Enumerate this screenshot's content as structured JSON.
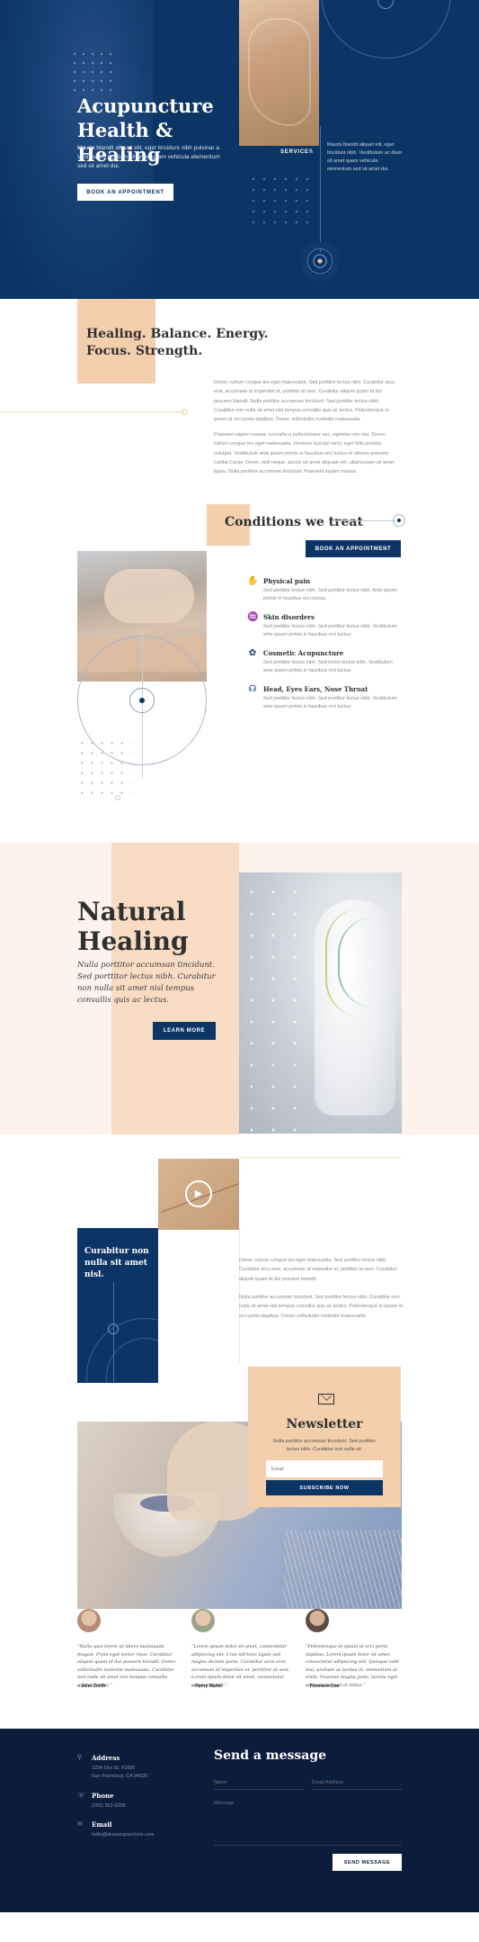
{
  "hero": {
    "title_line1": "Acupuncture",
    "title_line2": "Health & Healing",
    "text": "Mauris blandit aliquet elit, eget tincidunt nibh pulvinar a. Vestibulum ac diam sit amet quam vehicula elementum sed sit amet dui.",
    "button": "BOOK AN APPOINTMENT",
    "services_label": "SERVICES",
    "side_text": "Mauris blandit aliquet elit, eget tincidunt nibh. Vestibulum ac diam sit amet quam vehicula elementum sed sit amet dui."
  },
  "balance": {
    "title_line1": "Healing. Balance. Energy.",
    "title_line2": "Focus. Strength.",
    "para1": "Donec rutrum congue leo eget malesuada. Sed porttitor lectus nibh. Curabitur arcu erat, accumsan id imperdiet et, porttitor at sem. Curabitur aliquet quam id dui posuere blandit. Nulla porttitor accumsan tincidunt. Sed porttitor lectus nibh. Curabitur non nulla sit amet nisl tempus convallis quis ac lectus. Pellentesque in ipsum id orci porta dapibus. Donec sollicitudin molestie malesuada.",
    "para2": "Praesent sapien massa, convallis a pellentesque nec, egestas non nisi. Donec rutrum congue leo eget malesuada. Vivamus suscipit tortor eget felis porttitor volutpat. Vestibulum ante ipsum primis in faucibus orci luctus et ultrices posuere cubilia Curae; Donec velit neque, auctor sit amet aliquam vel, ullamcorper sit amet ligula. Nulla porttitor accumsan tincidunt. Praesent sapien massa."
  },
  "conditions": {
    "title": "Conditions we treat",
    "button": "BOOK AN APPOINTMENT",
    "items": [
      {
        "icon": "pain-hand-icon",
        "glyph": "✋",
        "title": "Physical pain",
        "text": "Sed porttitor lectus nibh. Sed porttitor lectus nibh. Ante ipsum primis in faucibus orci luctus."
      },
      {
        "icon": "skin-icon",
        "glyph": "♒",
        "title": "Skin disorders",
        "text": "Sed porttitor lectus nibh. Sed porttitor lectus nibh. Vestibulum ante ipsum primis in faucibus orci luctus."
      },
      {
        "icon": "cosmetic-icon",
        "glyph": "✿",
        "title": "Cosmetic Acupuncture",
        "text": "Sed porttitor lectus nibh. Sed lorem lectus nibh. Vestibulum ante ipsum primis in faucibus orci luctus."
      },
      {
        "icon": "head-icon",
        "glyph": "☊",
        "title": "Head, Eyes Ears, Nose Throat",
        "text": "Sed porttitor lectus nibh. Sed porttitor lectus nibh. Vestibulum ante ipsum primis in faucibus orci luctus."
      }
    ]
  },
  "natural": {
    "title_line1": "Natural",
    "title_line2": "Healing",
    "text": "Nulla porttitor accumsan tincidunt. Sed porttitor lectus nibh. Curabitur non nulla sit amet nisl tempus convallis quis ac lectus.",
    "button": "LEARN MORE"
  },
  "video": {
    "blue_title": "Curabitur non nulla sit amet nisl.",
    "para1": "Donec rutrum congue leo eget malesuada. Sed porttitor lectus nibh. Curabitur arcu erat, accumsan id imperdiet et, porttitor at sem. Curabitur aliquet quam id dui posuere blandit.",
    "para2": "Nulla porttitor accumsan tincidunt. Sed porttitor lectus nibh. Curabitur non nulla sit amet nisl tempus convallis quis ac lectus. Pellentesque in ipsum id orci porta dapibus. Donec sollicitudin molestie malesuada."
  },
  "newsletter": {
    "title": "Newsletter",
    "text": "Nulla porttitor accumsan tincidunt. Sed porttitor lectus nibh. Curabitur non nulla sit.",
    "email_placeholder": "Email",
    "button": "SUBSCRIBE NOW"
  },
  "testimonials": [
    {
      "quote": "“Nulla quis lorem ut libero malesuada feugiat. Proin eget tortor risus. Curabitur aliquet quam id dui posuere blandit. Donec sollicitudin molestie malesuada. Curabitur non nulla sit amet nisl tempus convallis quis ac lectus.”",
      "name": "– John Smith",
      "color": "#b88c74"
    },
    {
      "quote": "“Lorem ipsum dolor sit amet, consectetur adipiscing elit. Cras ultricies ligula sed magna dictum porta. Curabitur arcu erat, accumsan id imperdiet et, porttitor at sem. Lorem ipsum dolor sit amet, consectetur adipiscing elit.”",
      "name": "– Henry Muller",
      "color": "#9aa48a"
    },
    {
      "quote": "“Pellentesque in ipsum id orci porta dapibus. Lorem ipsum dolor sit amet, consectetur adipiscing elit. Quisque velit nisi, pretium ut lacinia in, elementum id enim. Vivamus magna justo, lacinia eget consectetur sed at tellus.”",
      "name": "– Thomson Doe",
      "color": "#7d6a5f"
    }
  ],
  "footer": {
    "address_label": "Address",
    "address_value": "1234 Divi St. #1000\nSan Francisco, CA 94220",
    "phone_label": "Phone",
    "phone_value": "(255) 352-6258",
    "email_label": "Email",
    "email_value": "hello@divoacupuncture.com",
    "form_title": "Send a message",
    "name_placeholder": "Name",
    "email_placeholder": "Email Address",
    "message_placeholder": "Message",
    "button": "SEND MESSAGE"
  }
}
